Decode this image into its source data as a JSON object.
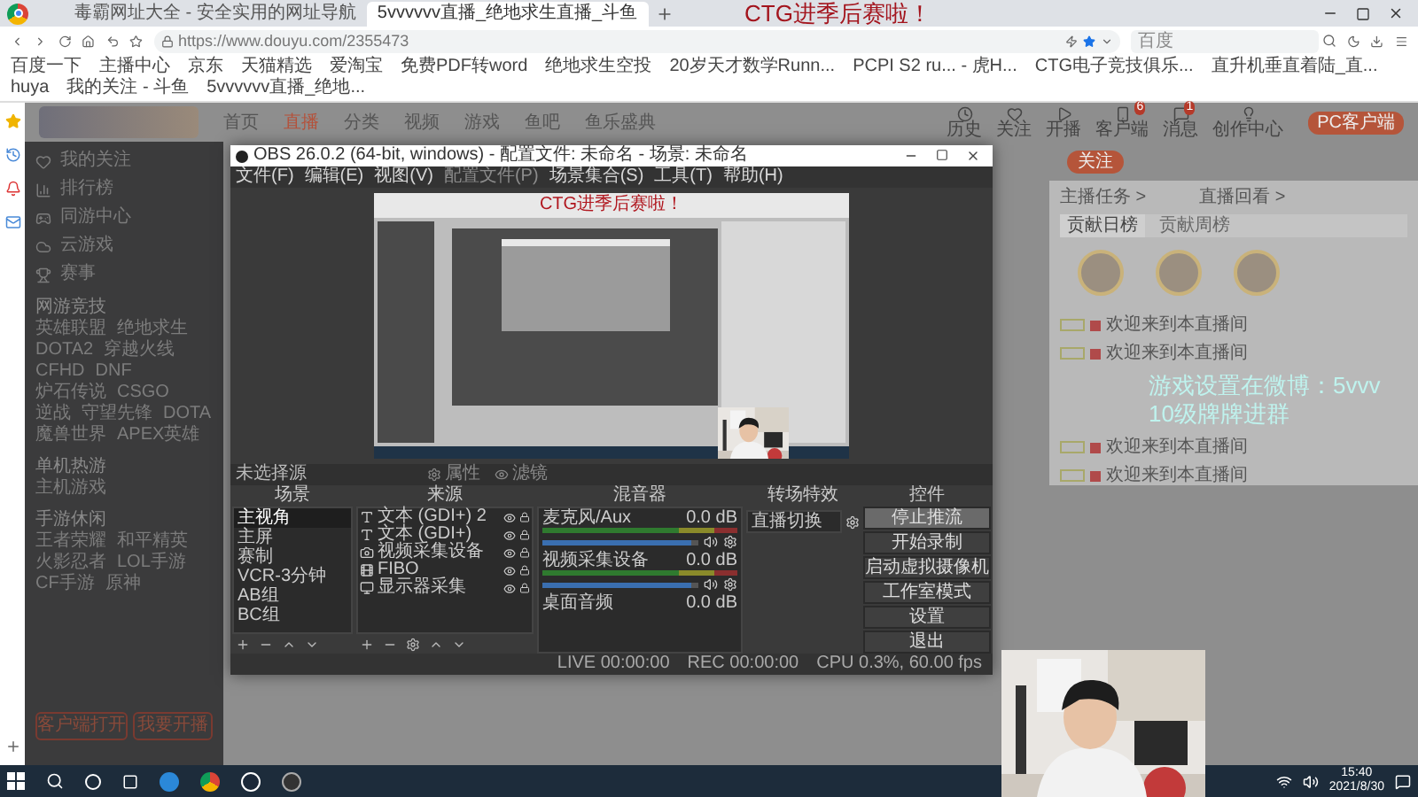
{
  "browser": {
    "tabs": [
      {
        "title": "毒霸网址大全 - 安全实用的网址导航",
        "selected": false
      },
      {
        "title": "5vvvvvv直播_绝地求生直播_斗鱼",
        "selected": true
      }
    ],
    "url": "https://www.douyu.com/2355473",
    "search": {
      "placeholder": "百度"
    },
    "bookmarks": [
      "百度一下",
      "主播中心",
      "京东",
      "天猫精选",
      "爱淘宝",
      "免费PDF转word",
      "绝地求生空投",
      "20岁天才数学Runn...",
      "PCPI S2 ru... - 虎H...",
      "CTG电子竞技俱乐...",
      "直升机垂直着陆_直...",
      "huya",
      "我的关注 - 斗鱼",
      "5vvvvvv直播_绝地..."
    ]
  },
  "stream_overlay": "CTG进季后赛啦！",
  "site": {
    "nav": [
      {
        "label": "首页",
        "selected": false
      },
      {
        "label": "直播",
        "selected": true
      },
      {
        "label": "分类",
        "selected": false
      },
      {
        "label": "视频",
        "selected": false
      },
      {
        "label": "游戏",
        "selected": false
      },
      {
        "label": "鱼吧",
        "selected": false
      },
      {
        "label": "鱼乐盛典",
        "selected": false
      }
    ],
    "actions": [
      {
        "label": "历史"
      },
      {
        "label": "关注"
      },
      {
        "label": "开播"
      },
      {
        "label": "客户端",
        "badge": "6"
      },
      {
        "label": "消息",
        "badge": "1"
      },
      {
        "label": "创作中心"
      }
    ],
    "sidebar": {
      "items": [
        "我的关注",
        "排行榜",
        "同游中心",
        "云游戏",
        "赛事"
      ],
      "sections": [
        {
          "title": "网游竞技",
          "games": [
            "英雄联盟",
            "绝地求生",
            "DOTA2",
            "穿越火线",
            "CFHD",
            "DNF",
            "炉石传说",
            "CSGO",
            "逆战",
            "守望先锋",
            "DOTA",
            "魔兽世界",
            "APEX英雄"
          ]
        },
        {
          "title": "单机热游",
          "games": [
            "主机游戏"
          ]
        },
        {
          "title": "手游休闲",
          "games": [
            "王者荣耀",
            "和平精英",
            "火影忍者",
            "LOL手游",
            "CF手游",
            "原神"
          ]
        }
      ],
      "buttons": [
        "客户端打开",
        "我要开播"
      ]
    },
    "follow_button": "关注",
    "client_button": "PC客户端",
    "chat": {
      "links": [
        "主播任务 >",
        "直播回看 >"
      ],
      "tabs": [
        {
          "label": "贡献日榜",
          "selected": true
        },
        {
          "label": "贡献周榜",
          "selected": false
        }
      ],
      "messages": [
        "欢迎来到本直播间",
        "欢迎来到本直播间",
        "欢迎来到本直播间",
        "欢迎来到本直播间"
      ]
    },
    "caption": [
      "游戏设置在微博：5vvv",
      "10级牌牌进群"
    ]
  },
  "obs": {
    "title": "OBS 26.0.2 (64-bit, windows) - 配置文件: 未命名 - 场景: 未命名",
    "menu": [
      {
        "label": "文件(F)",
        "disabled": false
      },
      {
        "label": "编辑(E)",
        "disabled": false
      },
      {
        "label": "视图(V)",
        "disabled": false
      },
      {
        "label": "配置文件(P)",
        "disabled": true
      },
      {
        "label": "场景集合(S)",
        "disabled": false
      },
      {
        "label": "工具(T)",
        "disabled": false
      },
      {
        "label": "帮助(H)",
        "disabled": false
      }
    ],
    "preview_caption": "CTG进季后赛啦！",
    "source_status": "未选择源",
    "source_buttons": [
      "属性",
      "滤镜"
    ],
    "headers": [
      "场景",
      "来源",
      "混音器",
      "转场特效",
      "控件"
    ],
    "scenes": [
      {
        "label": "主视角",
        "selected": true
      },
      {
        "label": "主屏",
        "selected": false
      },
      {
        "label": "赛制",
        "selected": false
      },
      {
        "label": "VCR-3分钟",
        "selected": false
      },
      {
        "label": "AB组",
        "selected": false
      },
      {
        "label": "BC组",
        "selected": false
      }
    ],
    "sources": [
      {
        "kind": "text",
        "label": "文本 (GDI+) 2"
      },
      {
        "kind": "text",
        "label": "文本 (GDI+)"
      },
      {
        "kind": "camera",
        "label": "视频采集设备"
      },
      {
        "kind": "media",
        "label": "FIBO"
      },
      {
        "kind": "display",
        "label": "显示器采集"
      }
    ],
    "mixer": [
      {
        "name": "麦克风/Aux",
        "reading": "0.0 dB",
        "level": 0.95
      },
      {
        "name": "视频采集设备",
        "reading": "0.0 dB",
        "level": 0.95
      },
      {
        "name": "桌面音频",
        "reading": "0.0 dB"
      }
    ],
    "transition": "直播切换",
    "controls": [
      {
        "label": "停止推流",
        "selected": true
      },
      {
        "label": "开始录制",
        "selected": false
      },
      {
        "label": "启动虚拟摄像机",
        "selected": false
      },
      {
        "label": "工作室模式",
        "selected": false
      },
      {
        "label": "设置",
        "selected": false
      },
      {
        "label": "退出",
        "selected": false
      }
    ],
    "status": [
      "LIVE 00:00:00",
      "REC 00:00:00",
      "CPU 0.3%, 60.00 fps"
    ]
  },
  "taskbar": {
    "time": "15:40",
    "date": "2021/8/30"
  }
}
